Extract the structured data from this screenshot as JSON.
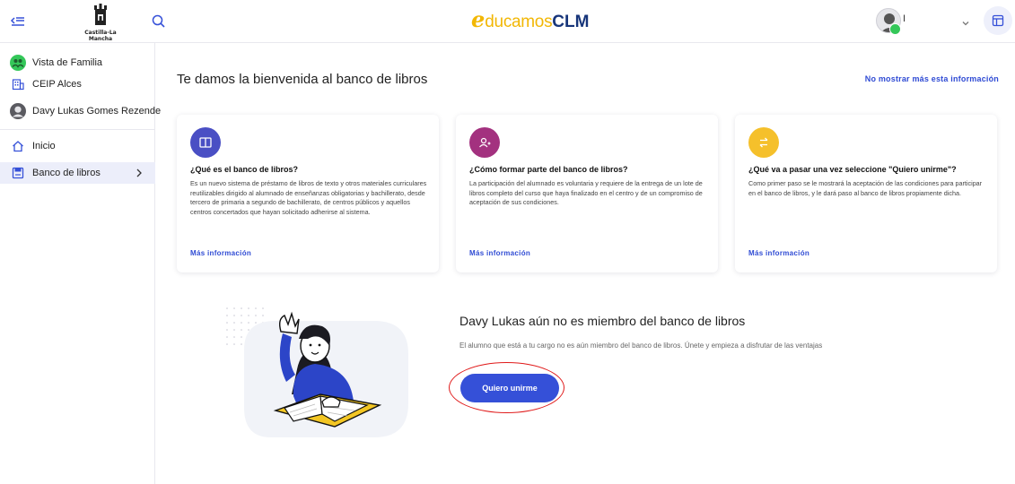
{
  "header": {
    "logo_text": "Castilla-La Mancha",
    "brand_e": "e",
    "brand_ducamos": "ducamos",
    "brand_clm": "CLM",
    "user_initial": "I",
    "icons": [
      "collapse-menu-icon",
      "search-icon",
      "chevron-down-icon",
      "layout-icon"
    ]
  },
  "sidebar": {
    "family_view": "Vista de Familia",
    "school": "CEIP Alces",
    "student": "Davy Lukas Gomes Rezende",
    "nav": [
      {
        "label": "Inicio",
        "icon": "home-icon"
      },
      {
        "label": "Banco de libros",
        "icon": "book-bank-icon"
      }
    ]
  },
  "main": {
    "welcome_title": "Te damos la bienvenida al banco de libros",
    "dismiss_link": "No mostrar más esta información",
    "cards": [
      {
        "title": "¿Qué es el banco de libros?",
        "text": "Es un nuevo sistema de préstamo de libros de texto y otros materiales curriculares reutilizables dirigido al alumnado de enseñanzas obligatorias y bachillerato, desde tercero de primaria a segundo de bachillerato, de centros públicos y aquellos centros concertados que hayan solicitado adherirse al sistema.",
        "more": "Más información",
        "color": "#4a4fc4",
        "icon": "book-open-icon"
      },
      {
        "title": "¿Cómo formar parte del banco de libros?",
        "text": "La participación del alumnado es voluntaria y requiere de la entrega de un lote de libros completo del curso que haya finalizado en el centro y de un compromiso de aceptación de sus condiciones.",
        "more": "Más información",
        "color": "#a3317f",
        "icon": "add-person-icon"
      },
      {
        "title": "¿Qué va a pasar una vez seleccione \"Quiero unirme\"?",
        "text": "Como primer paso se le mostrará la aceptación de las condiciones para participar en el banco de libros, y le dará paso al banco de libros propiamente dicha.",
        "more": "Más información",
        "color": "#f5c02b",
        "icon": "exchange-icon"
      }
    ],
    "member_title": "Davy Lukas aún no es miembro del banco de libros",
    "member_desc": "El alumno que está a tu cargo no es aún miembro del banco de libros. Únete y empieza a disfrutar de las ventajas",
    "join_button": "Quiero unirme",
    "colors": {
      "primary": "#3550d8",
      "highlight_ring": "#e01b1b",
      "brand_yellow": "#f2b705",
      "brand_navy": "#17357a"
    }
  }
}
